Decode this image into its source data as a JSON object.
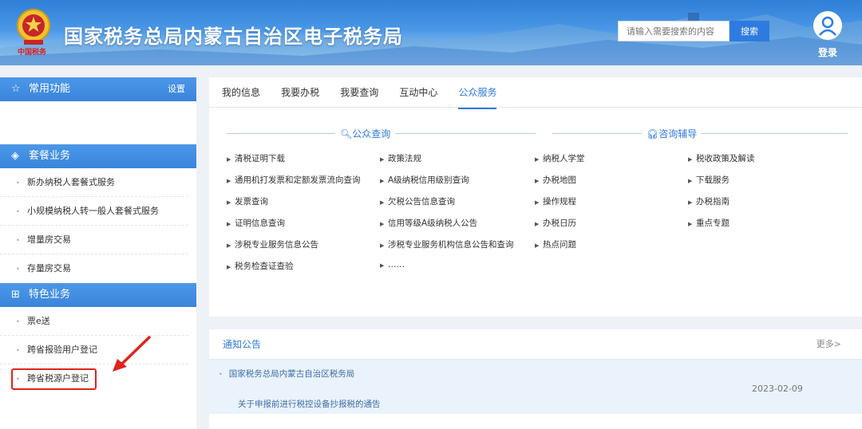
{
  "header": {
    "title": "国家税务总局内蒙古自治区电子税务局",
    "emblem_text": "中国税务",
    "search_placeholder": "请输入需要搜索的内容",
    "search_button": "搜索",
    "login_label": "登录"
  },
  "sidebar": {
    "common": {
      "label": "常用功能",
      "settings": "设置"
    },
    "package": {
      "label": "套餐业务",
      "items": [
        {
          "label": "新办纳税人套餐式服务"
        },
        {
          "label": "小规模纳税人转一般人套餐式服务"
        },
        {
          "label": "增量房交易"
        },
        {
          "label": "存量房交易"
        }
      ]
    },
    "feature": {
      "label": "特色业务",
      "items": [
        {
          "label": "票e送"
        },
        {
          "label": "跨省报验用户登记"
        },
        {
          "label": "跨省税源户登记"
        }
      ]
    }
  },
  "tabs": [
    {
      "label": "我的信息"
    },
    {
      "label": "我要办税"
    },
    {
      "label": "我要查询"
    },
    {
      "label": "互动中心"
    },
    {
      "label": "公众服务"
    }
  ],
  "public_query": {
    "title": "公众查询",
    "col1": [
      "清税证明下载",
      "通用机打发票和定额发票流向查询",
      "发票查询",
      "证明信息查询",
      "涉税专业服务信息公告",
      "税务检查证查验"
    ],
    "col2": [
      "政策法规",
      "A级纳税信用级别查询",
      "欠税公告信息查询",
      "信用等级A级纳税人公告",
      "涉税专业服务机构信息公告和查询",
      "……"
    ]
  },
  "consult": {
    "title": "咨询辅导",
    "col1": [
      "纳税人学堂",
      "办税地图",
      "操作规程",
      "办税日历",
      "热点问题"
    ],
    "col2": [
      "税收政策及解读",
      "下载服务",
      "办税指南",
      "重点专题"
    ]
  },
  "notice": {
    "title": "通知公告",
    "more": "更多>",
    "org": "国家税务总局内蒙古自治区税务局",
    "date": "2023-02-09",
    "item": "关于申报前进行税控设备抄报税的通告"
  },
  "colors": {
    "accent": "#2e7be0",
    "highlight": "#e0241b"
  }
}
